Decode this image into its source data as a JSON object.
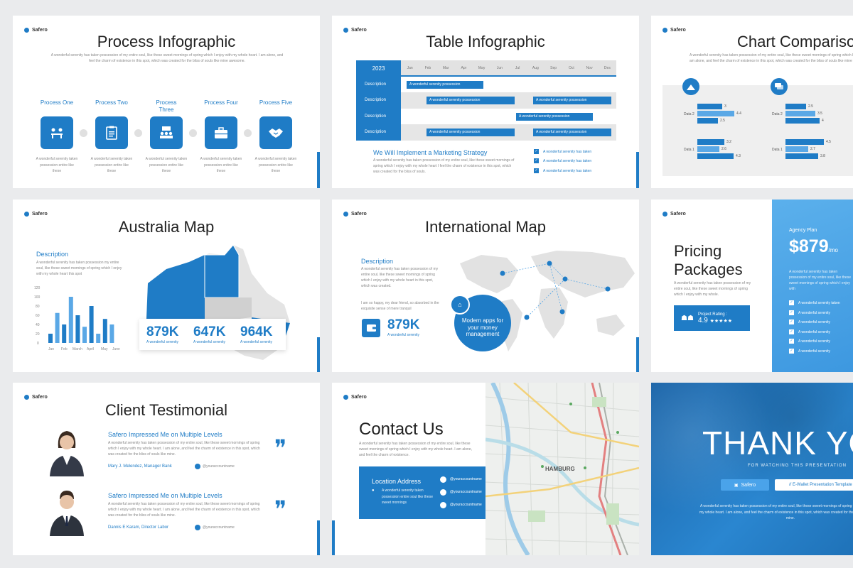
{
  "brand": "Safero",
  "lorem_long": "A wonderful serenity has taken possession of my entire soul, like these sweet mornings of spring which I enjoy with my whole heart. I am alone, and feel the charm of existence in this spot, which was created for the bliss of souls like mine awesome.",
  "process": {
    "title": "Process Infographic",
    "items": [
      {
        "label": "Process One",
        "desc": "A wonderful serenity taken possession entire like these"
      },
      {
        "label": "Process Two",
        "desc": "A wonderful serenity taken possession entire like these"
      },
      {
        "label": "Process Three",
        "desc": "A wonderful serenity taken possession entire like these"
      },
      {
        "label": "Process Four",
        "desc": "A wonderful serenity taken possession entire like these"
      },
      {
        "label": "Process Five",
        "desc": "A wonderful serenity taken possession entire like these"
      }
    ],
    "icons": [
      "meeting-icon",
      "clipboard-icon",
      "team-board-icon",
      "briefcase-icon",
      "handshake-icon"
    ]
  },
  "table": {
    "title": "Table Infographic",
    "year": "2023",
    "months": [
      "Jan",
      "Feb",
      "Mar",
      "Apr",
      "May",
      "Jun",
      "Jul",
      "Aug",
      "Sep",
      "Oct",
      "Nov",
      "Des"
    ],
    "row_label": "Description",
    "bar_text": "A wonderful serenity possession",
    "heading": "We Will Implement a Marketing Strategy",
    "body": "A wonderful serenity has taken possession of my entire soul, like these sweet mornings of spring which I enjoy with my whole heart I feel the charm of existence in this spot, which was created for the bliss of souls.",
    "checks": [
      "A wonderful serenity has taken",
      "A wonderful serenity has taken",
      "A wonderful serenity has taken"
    ]
  },
  "comparison": {
    "title": "Chart Comparison",
    "labels": [
      "Data 2",
      "Data 1"
    ],
    "values": [
      "3",
      "4.4",
      "2.5",
      "3.2",
      "2.6",
      "4.3",
      "2.5",
      "3.5",
      "4",
      "4.5",
      "2.7",
      "3.8"
    ]
  },
  "australia": {
    "title": "Australia Map",
    "desc_title": "Description",
    "desc": "A wonderful serenity has taken possession my entire soul, like these sweet mornings of spring which I enjoy with my whole heart this spot",
    "stats": [
      {
        "value": "879K",
        "label": "A wonderful serenity"
      },
      {
        "value": "647K",
        "label": "A wonderful serenity"
      },
      {
        "value": "964K",
        "label": "A wonderful serenity"
      }
    ],
    "chart": {
      "months": [
        "Jan",
        "Feb",
        "March",
        "April",
        "May",
        "June"
      ],
      "ticks": [
        "120",
        "100",
        "80",
        "60",
        "40",
        "20",
        "0"
      ],
      "values": [
        20,
        65,
        40,
        100,
        60,
        35,
        80,
        20,
        52,
        40
      ]
    }
  },
  "international": {
    "title": "International Map",
    "desc_title": "Description",
    "desc1": "A wonderful serenity has taken possession of my entire soul, like these sweet mornings of spring which I enjoy with my whole heart in this spot, which was created.",
    "desc2": "I am so happy, my dear friend, so absorbed in the exquisite sense of mere tranquil",
    "stat_value": "879K",
    "stat_label": "A wonderful serenity",
    "bubble": "Modern apps for your money management"
  },
  "pricing": {
    "title_line1": "Pricing",
    "title_line2": "Packages",
    "desc": "A wonderful serenity has taken possession of my entire soul, like these sweet mornings of spring which I enjoy with my whole.",
    "rating_label": "Project Rating :",
    "rating_value": "4.9",
    "stars": "★★★★★",
    "plan": "Agency Plan",
    "price": "$879",
    "per": "/mo",
    "plan_desc": "A wonderful serenity has taken possession of my entire soul, like these sweet mornings of spring which I enjoy with",
    "features": [
      "A wonderful serenity taken",
      "A wonderful serenity",
      "A wonderful serenity",
      "A wonderful serenity",
      "A wonderful serenity",
      "A wonderful serenity"
    ]
  },
  "testimonial": {
    "title": "Client Testimonial",
    "items": [
      {
        "heading": "Safero Impressed Me on Multiple Levels",
        "body": "A wonderful serenity has taken possession of my entire soul, like these sweet mornings of spring which I enjoy with my whole heart. I am alone, and feel the charm of existence in this spot, which was created for the bliss of souls like mine.",
        "name": "Mary J. Melendez, Manager Bank",
        "handle": "@youraccountname"
      },
      {
        "heading": "Safero Impressed Me on Multiple Levels",
        "body": "A wonderful serenity has taken possession of my entire soul, like these sweet mornings of spring which I enjoy with my whole heart. I am alone, and feel the charm of existence in this spot, which was created for the bliss of souls like mine.",
        "name": "Dannis E Karam, Director Labor",
        "handle": "@youraccountname"
      }
    ],
    "quote": "❞"
  },
  "contact": {
    "title": "Contact Us",
    "desc": "A wonderful serenity has taken possession of my entire soul, like these sweet mornings of spring which I enjoy with my whole heart. I am alone, and feel the charm of existence.",
    "loc_title": "Location Address",
    "loc_desc": "A wonderful serenity taken possession entire soul like these sweet mornings",
    "socials": [
      "@youraccountname",
      "@youraccountname",
      "@youraccountname"
    ],
    "map_label": "HAMBURG"
  },
  "thanks": {
    "title": "THANK YOU",
    "subtitle": "FOR WATCHING THIS PRESENTATION",
    "btn1": "Safero",
    "btn2": "// E-Wallet Presentation Template",
    "body": "A wonderful serenity has taken possession of my entire soul, like these sweet mornings of spring which I enjoy with my whole heart. I am alone, and feel the charm of existence in this spot, which was created for the bliss of souls like mine."
  },
  "colors": {
    "primary": "#1f7cc6",
    "light": "#5aa8e6",
    "background": "#eaebed"
  }
}
